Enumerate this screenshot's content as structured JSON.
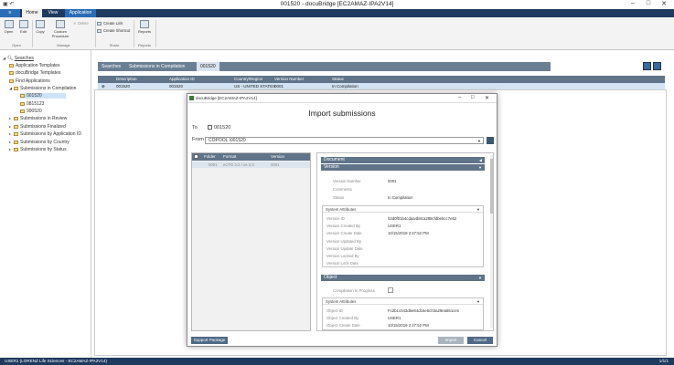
{
  "window": {
    "title": "001520 - docuBridge [EC2AMAZ-IPA2V14]",
    "quick_access": "▣ ↶"
  },
  "ribbon": {
    "tabs": [
      "Home",
      "View",
      "Application"
    ],
    "file_tab": "",
    "open_group": {
      "open": "Open",
      "edit": "Edit",
      "label": "Open"
    },
    "manage_group": {
      "copy": "Copy",
      "custom": "Custom Procedure",
      "delete": "Delete",
      "label": "Manage"
    },
    "share_group": {
      "create_link": "Create Link",
      "create_shortcut": "Create Shortcut",
      "label": "Share"
    },
    "reports_group": {
      "reports": "Reports",
      "label": "Reports"
    }
  },
  "sidebar": {
    "root": "Searches",
    "items": [
      "Application Templates",
      "docuBridge Templates",
      "Find Applications",
      "Submissions in Compilation",
      "001520",
      "0815123",
      "990520",
      "Submissions in Review",
      "Submissions Finalized",
      "Submissions by Application ID",
      "Submissions by Country",
      "Submissions by Status"
    ]
  },
  "breadcrumb": {
    "items": [
      "Searches",
      "Submissions in Compilation",
      "001520"
    ]
  },
  "grid": {
    "headers": [
      "Description",
      "Application ID",
      "Country/Region",
      "Version Number",
      "Status"
    ],
    "row": {
      "description": "001520",
      "application_id": "001520",
      "country": "US - UNITED STATES",
      "version": "0001",
      "status": "In Compilation"
    }
  },
  "dialog": {
    "titlebar": "docuBridge [EC2AMAZ-IPA2V14]",
    "heading": "Import submissions",
    "to_label": "To",
    "to_value": "001520",
    "from_label": "From",
    "from_value": "COPOOL \\001520",
    "left_headers": [
      "Folder",
      "Format",
      "Version"
    ],
    "left_row": {
      "folder": "0001",
      "format": "eCTD 3.2 / us 3.3",
      "version": "0001"
    },
    "document_section": "Document",
    "version_section": "Version",
    "version_fields": {
      "version_number_label": "Version Number",
      "version_number_value": "0001",
      "comments_label": "Comments",
      "status_label": "Status",
      "status_value": "In Compilation"
    },
    "system_attributes": "System Attributes",
    "version_system": {
      "version_id_label": "Version ID",
      "version_id_value": "\\t2d0f01b4cdaa4b8ca288cfdbe5cc7e52",
      "created_by_label": "Version Created By",
      "created_by_value": "USER1",
      "create_date_label": "Version Create Date",
      "create_date_value": "10/15/2019 2:47:52 PM",
      "updated_by_label": "Version Updated By",
      "update_date_label": "Version Update Date",
      "locked_by_label": "Version Locked By",
      "lock_date_label": "Version Lock Date"
    },
    "object_section": "Object",
    "compilation_label": "Compilation In Progress",
    "object_system": {
      "object_id_label": "Object ID",
      "object_id_value": "Fc2b1c043d6e84d16e6c03a29ea651ces",
      "created_by_label": "Object Created By",
      "created_by_value": "USER1",
      "create_date_label": "Object Create Date",
      "create_date_value": "10/15/2019 2:47:52 PM"
    },
    "support_package": "Support Package",
    "import": "Import",
    "cancel": "Cancel"
  },
  "status_bar": {
    "left": "USER1 (LORENZ Life Sciences - EC2AMAZ-IPA2V14)",
    "right": "1/1/1"
  },
  "colors": {
    "ribbon_dark": "#1e3a5f",
    "header_gray": "#5f7389",
    "file_tab": "#2a6db5",
    "selection": "#cde3f7"
  }
}
